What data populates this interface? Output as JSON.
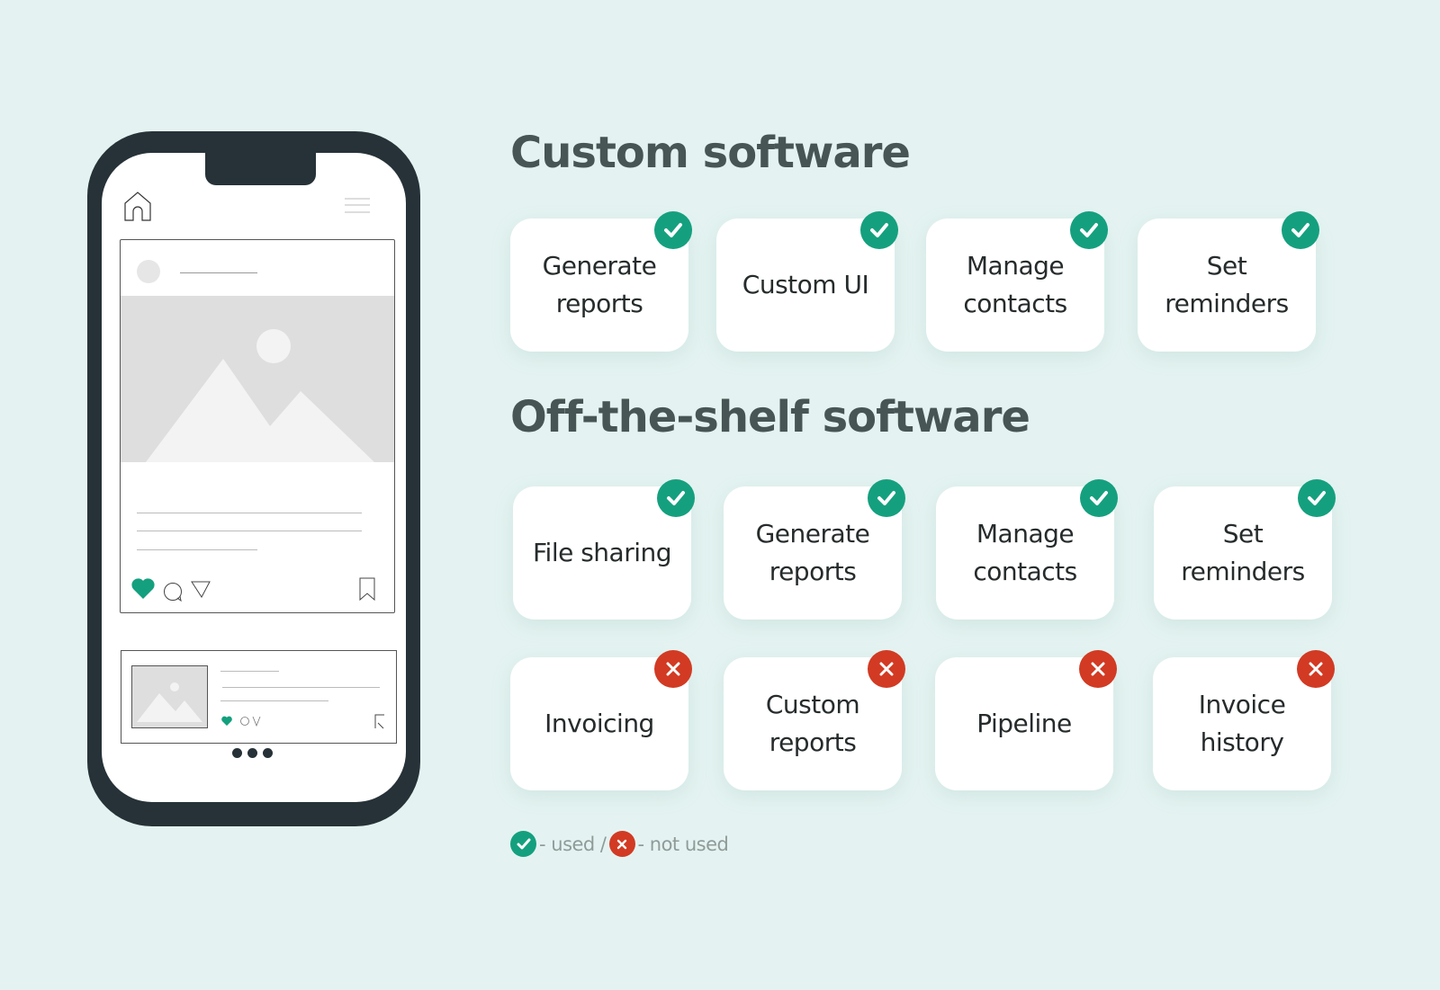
{
  "phone_mockup": {
    "post_actions": [
      "heart-icon",
      "comment-icon",
      "send-icon",
      "bookmark-icon"
    ],
    "pager_dots": 3,
    "accent_color": "#14a07e"
  },
  "sections": [
    {
      "title": "Custom software",
      "features": [
        {
          "label": "Generate reports",
          "status": "used"
        },
        {
          "label": "Custom UI",
          "status": "used"
        },
        {
          "label": "Manage contacts",
          "status": "used"
        },
        {
          "label": "Set reminders",
          "status": "used"
        }
      ]
    },
    {
      "title": "Off-the-shelf software",
      "features": [
        {
          "label": "File sharing",
          "status": "used"
        },
        {
          "label": "Generate reports",
          "status": "used"
        },
        {
          "label": "Manage contacts",
          "status": "used"
        },
        {
          "label": "Set reminders",
          "status": "used"
        },
        {
          "label": "Invoicing",
          "status": "not used"
        },
        {
          "label": "Custom reports",
          "status": "not used"
        },
        {
          "label": "Pipeline",
          "status": "not used"
        },
        {
          "label": "Invoice history",
          "status": "not used"
        }
      ]
    }
  ],
  "legend": {
    "used_label": "- used /",
    "not_used_label": "- not used"
  },
  "colors": {
    "used": "#14a07e",
    "not_used": "#d23a23",
    "heading": "#475654",
    "background": "#e4f3f1",
    "phone_frame": "#263238"
  }
}
